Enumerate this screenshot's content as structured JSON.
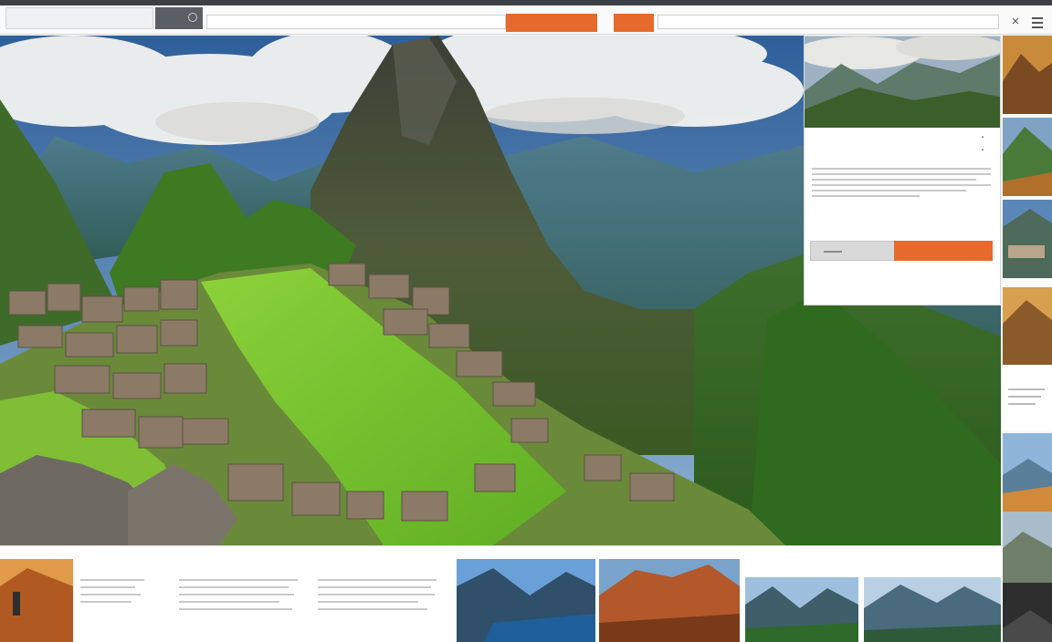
{
  "toolbar": {
    "url": "",
    "menu_label": "",
    "search_placeholder": "",
    "primary_button": "",
    "secondary_button": "",
    "search2_placeholder": "",
    "search2_suffix": ""
  },
  "booking": {
    "title": "",
    "subtitle": "",
    "price": "",
    "date": "",
    "book_button": "",
    "link": "",
    "footer_left": "",
    "footer_right": ""
  },
  "side": {
    "title": "",
    "price": ""
  },
  "bottom": {
    "col1_title": "",
    "col2_title": "",
    "col3_title": "",
    "col4_title": "",
    "col5_title": ""
  },
  "colors": {
    "accent": "#e56a2c",
    "toolbar_dark": "#3c3f44"
  }
}
